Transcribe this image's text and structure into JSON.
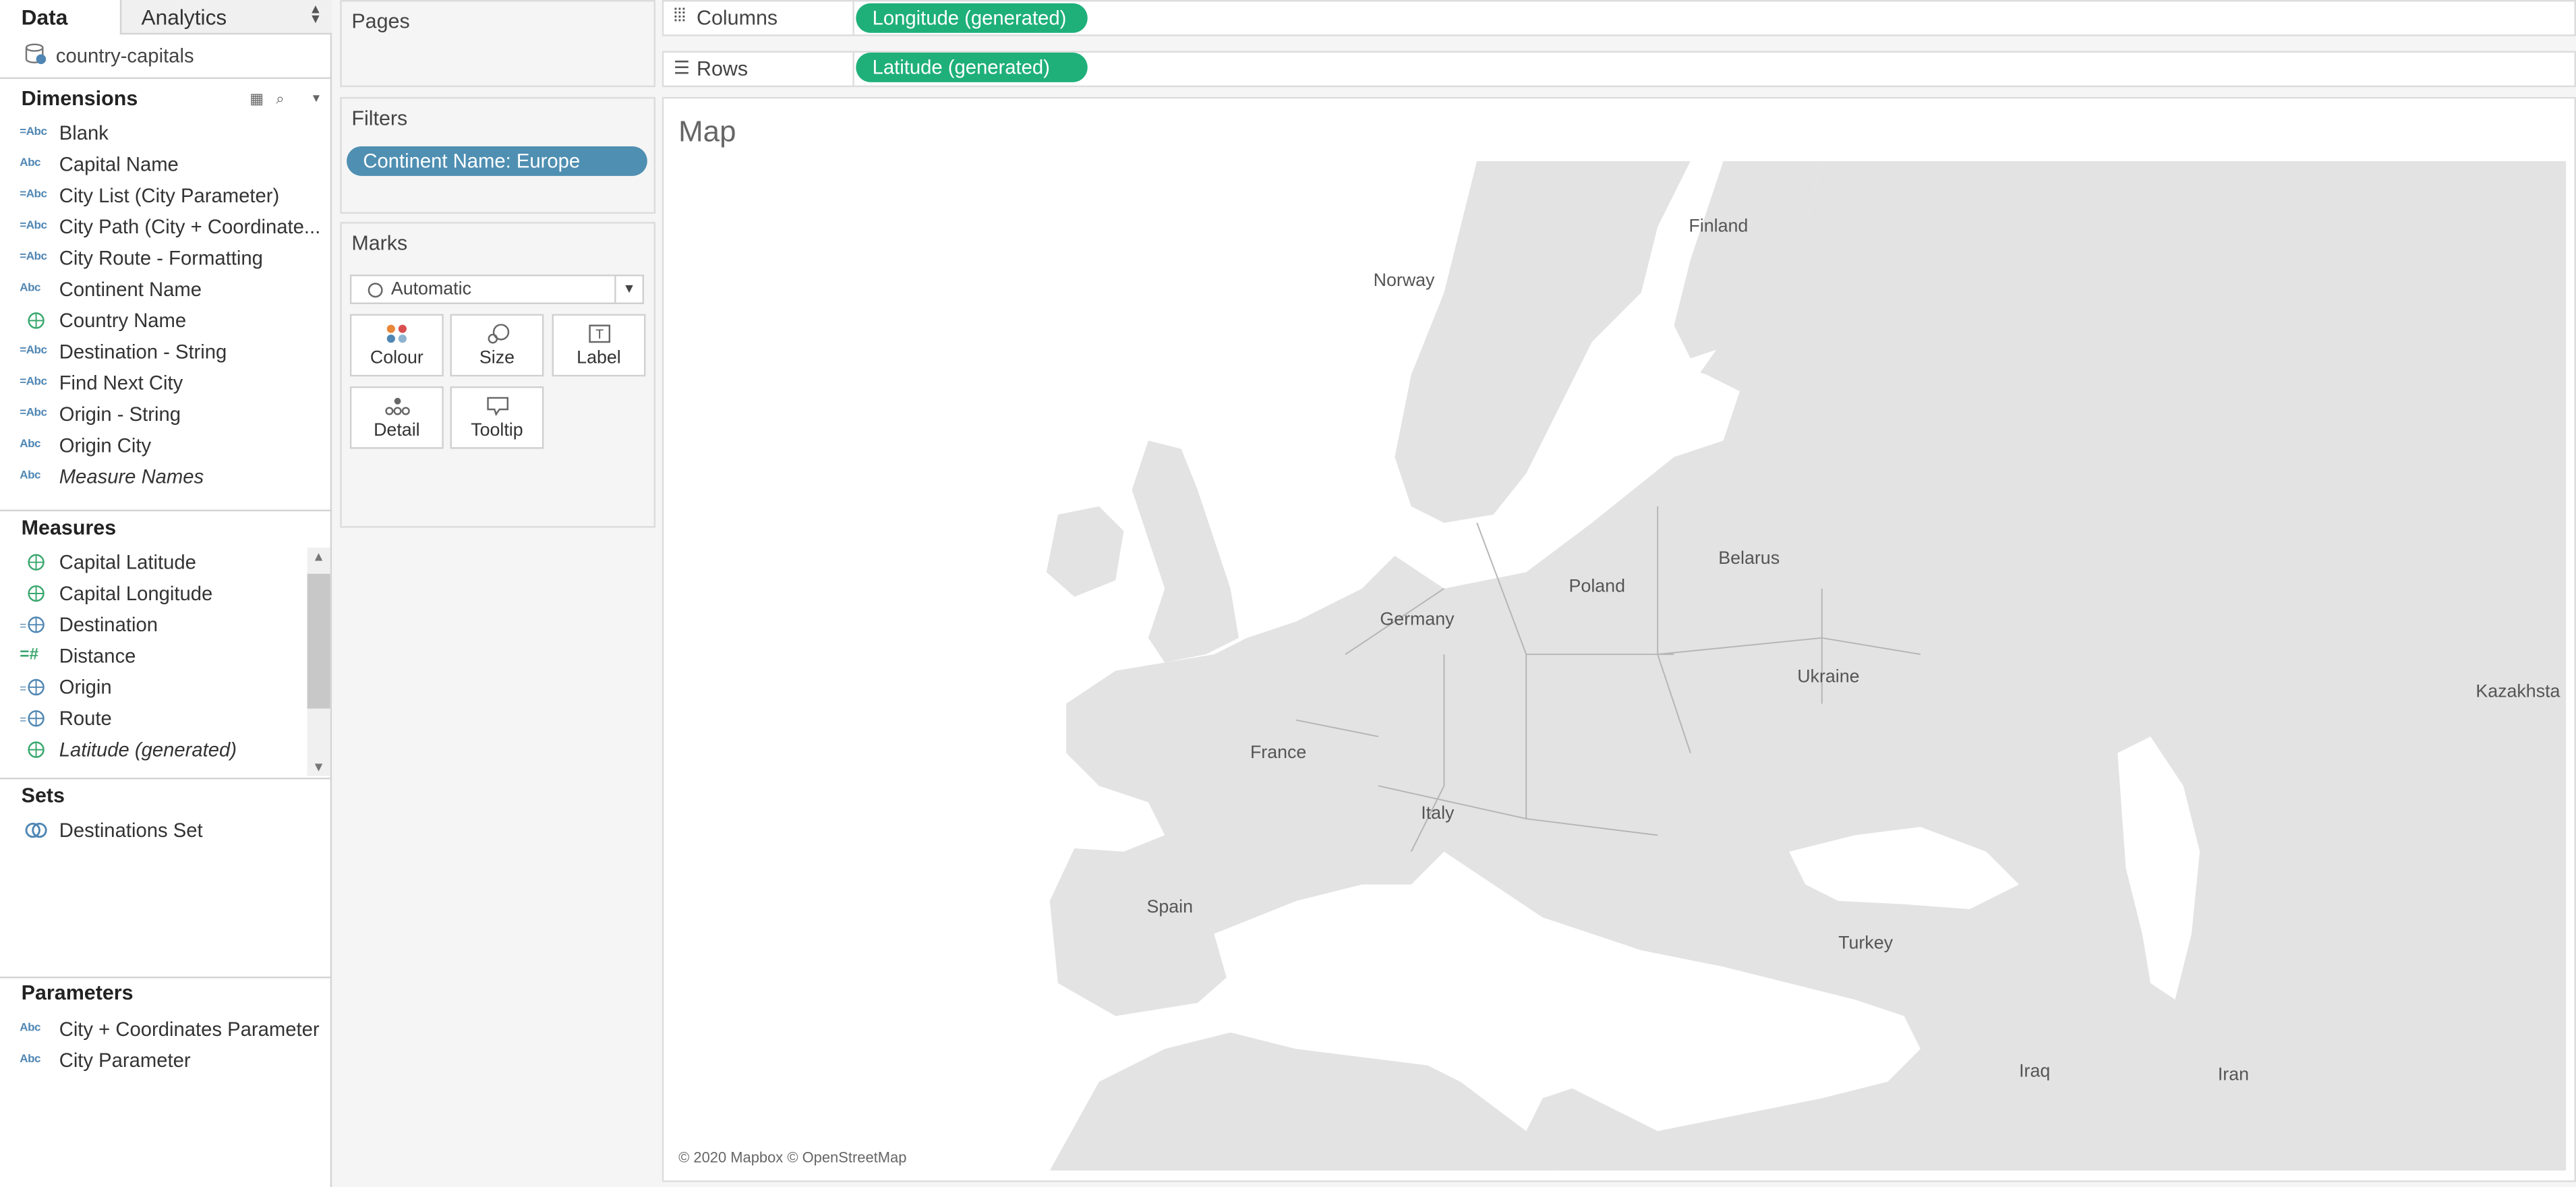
{
  "tabs": {
    "data": "Data",
    "analytics": "Analytics"
  },
  "datasource": {
    "name": "country-capitals"
  },
  "dimensions": {
    "title": "Dimensions",
    "items": [
      {
        "label": "Blank",
        "icon": "=Abc",
        "italic": false
      },
      {
        "label": "Capital Name",
        "icon": "Abc",
        "italic": false
      },
      {
        "label": "City List (City Parameter)",
        "icon": "=Abc",
        "italic": false
      },
      {
        "label": "City Path (City + Coordinate...",
        "icon": "=Abc",
        "italic": false
      },
      {
        "label": "City Route - Formatting",
        "icon": "=Abc",
        "italic": false
      },
      {
        "label": "Continent Name",
        "icon": "Abc",
        "italic": false
      },
      {
        "label": "Country Name",
        "icon": "globe",
        "italic": false
      },
      {
        "label": "Destination - String",
        "icon": "=Abc",
        "italic": false
      },
      {
        "label": "Find Next City",
        "icon": "=Abc",
        "italic": false
      },
      {
        "label": "Origin - String",
        "icon": "=Abc",
        "italic": false
      },
      {
        "label": "Origin City",
        "icon": "Abc",
        "italic": false
      },
      {
        "label": "Measure Names",
        "icon": "Abc",
        "italic": true
      }
    ]
  },
  "measures": {
    "title": "Measures",
    "items": [
      {
        "label": "Capital Latitude",
        "icon": "globe",
        "italic": false
      },
      {
        "label": "Capital Longitude",
        "icon": "globe",
        "italic": false
      },
      {
        "label": "Destination",
        "icon": "=globe",
        "italic": false
      },
      {
        "label": "Distance",
        "icon": "=#",
        "italic": false
      },
      {
        "label": "Origin",
        "icon": "=globe",
        "italic": false
      },
      {
        "label": "Route",
        "icon": "=globe",
        "italic": false
      },
      {
        "label": "Latitude (generated)",
        "icon": "globe",
        "italic": true
      }
    ]
  },
  "sets": {
    "title": "Sets",
    "items": [
      {
        "label": "Destinations Set"
      }
    ]
  },
  "parameters": {
    "title": "Parameters",
    "items": [
      {
        "label": "City + Coordinates Parameter",
        "icon": "Abc"
      },
      {
        "label": "City Parameter",
        "icon": "Abc"
      }
    ]
  },
  "cards": {
    "pages": "Pages",
    "filters": "Filters",
    "filter_pill": "Continent Name: Europe",
    "marks": "Marks",
    "mark_type": "Automatic",
    "mark_buttons": {
      "colour": "Colour",
      "size": "Size",
      "label": "Label",
      "detail": "Detail",
      "tooltip": "Tooltip"
    }
  },
  "shelves": {
    "columns_label": "Columns",
    "columns_pill": "Longitude (generated)",
    "rows_label": "Rows",
    "rows_pill": "Latitude (generated)"
  },
  "viz": {
    "title": "Map",
    "attribution": "© 2020 Mapbox © OpenStreetMap",
    "places": {
      "finland": "Finland",
      "norway": "Norway",
      "poland": "Poland",
      "belarus": "Belarus",
      "germany": "Germany",
      "ukraine": "Ukraine",
      "france": "France",
      "italy": "Italy",
      "spain": "Spain",
      "turkey": "Turkey",
      "iraq": "Iraq",
      "iran": "Iran",
      "kazakhstan": "Kazakhsta"
    }
  },
  "colors": {
    "accent_blue": "#4f8fb2",
    "pill_green": "#1fb07a",
    "land": "#e3e3e3",
    "water": "#ffffff"
  }
}
